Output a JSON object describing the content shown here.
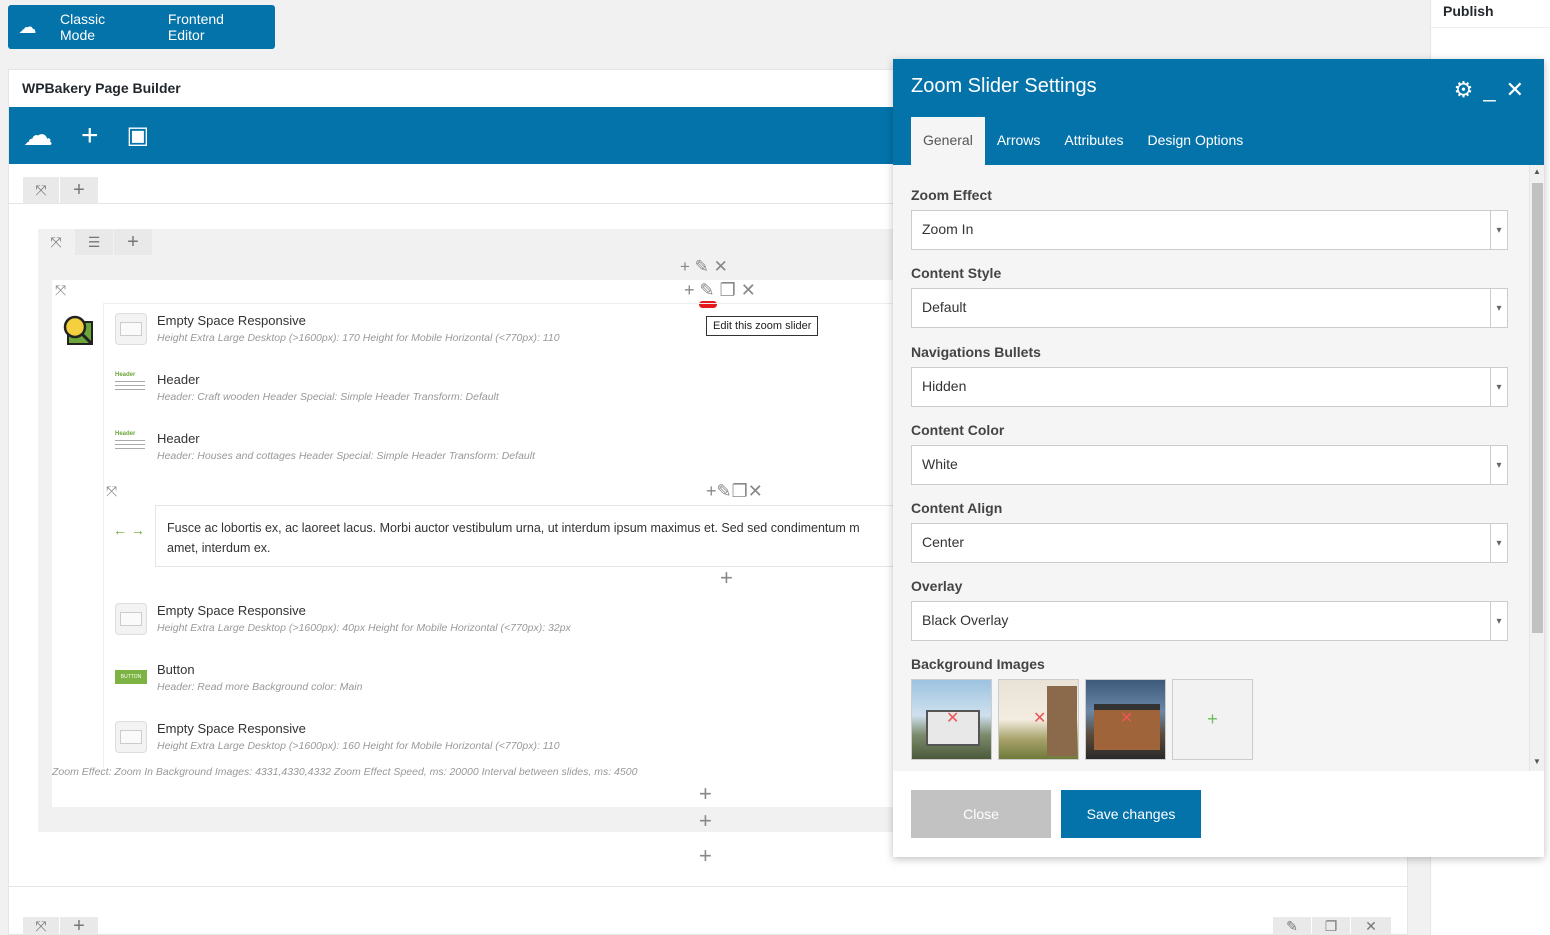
{
  "topbar": {
    "classic_label": "Classic Mode",
    "frontend_label": "Frontend Editor"
  },
  "publish": {
    "title": "Publish"
  },
  "builder": {
    "title": "WPBakery Page Builder",
    "tooltip": "Edit this zoom slider",
    "elements": [
      {
        "title": "Empty Space Responsive",
        "desc": "Height Extra Large Desktop (>1600px): 170  Height for Mobile Horizontal (<770px): 110"
      },
      {
        "title": "Header",
        "desc": "Header: Craft wooden  Header Special: Simple Header  Transform: Default"
      },
      {
        "title": "Header",
        "desc": "Header: Houses and cottages  Header Special: Simple Header  Transform: Default"
      },
      {
        "title": "Empty Space Responsive",
        "desc": "Height Extra Large Desktop (>1600px): 40px  Height for Mobile Horizontal (<770px): 32px"
      },
      {
        "title": "Button",
        "desc": "Header: Read more  Background color: Main"
      },
      {
        "title": "Empty Space Responsive",
        "desc": "Height Extra Large Desktop (>1600px): 160  Height for Mobile Horizontal (<770px): 110"
      }
    ],
    "text_block": "Fusce ac lobortis ex, ac laoreet lacus. Morbi auctor vestibulum urna, ut interdum ipsum maximus et. Sed sed condimentum m amet, interdum ex.",
    "slider_summary": "Zoom Effect: Zoom In  Background Images: 4331,4330,4332  Zoom Effect Speed, ms: 20000  Interval between slides, ms: 4500",
    "header_icon_text": "Header",
    "button_icon_text": "BUTTON"
  },
  "modal": {
    "title": "Zoom Slider Settings",
    "tabs": [
      "General",
      "Arrows",
      "Attributes",
      "Design Options"
    ],
    "fields": [
      {
        "label": "Zoom Effect",
        "value": "Zoom In"
      },
      {
        "label": "Content Style",
        "value": "Default"
      },
      {
        "label": "Navigations Bullets",
        "value": "Hidden"
      },
      {
        "label": "Content Color",
        "value": "White"
      },
      {
        "label": "Content Align",
        "value": "Center"
      },
      {
        "label": "Overlay",
        "value": "Black Overlay"
      }
    ],
    "bg_images_label": "Background Images",
    "close_label": "Close",
    "save_label": "Save changes"
  }
}
